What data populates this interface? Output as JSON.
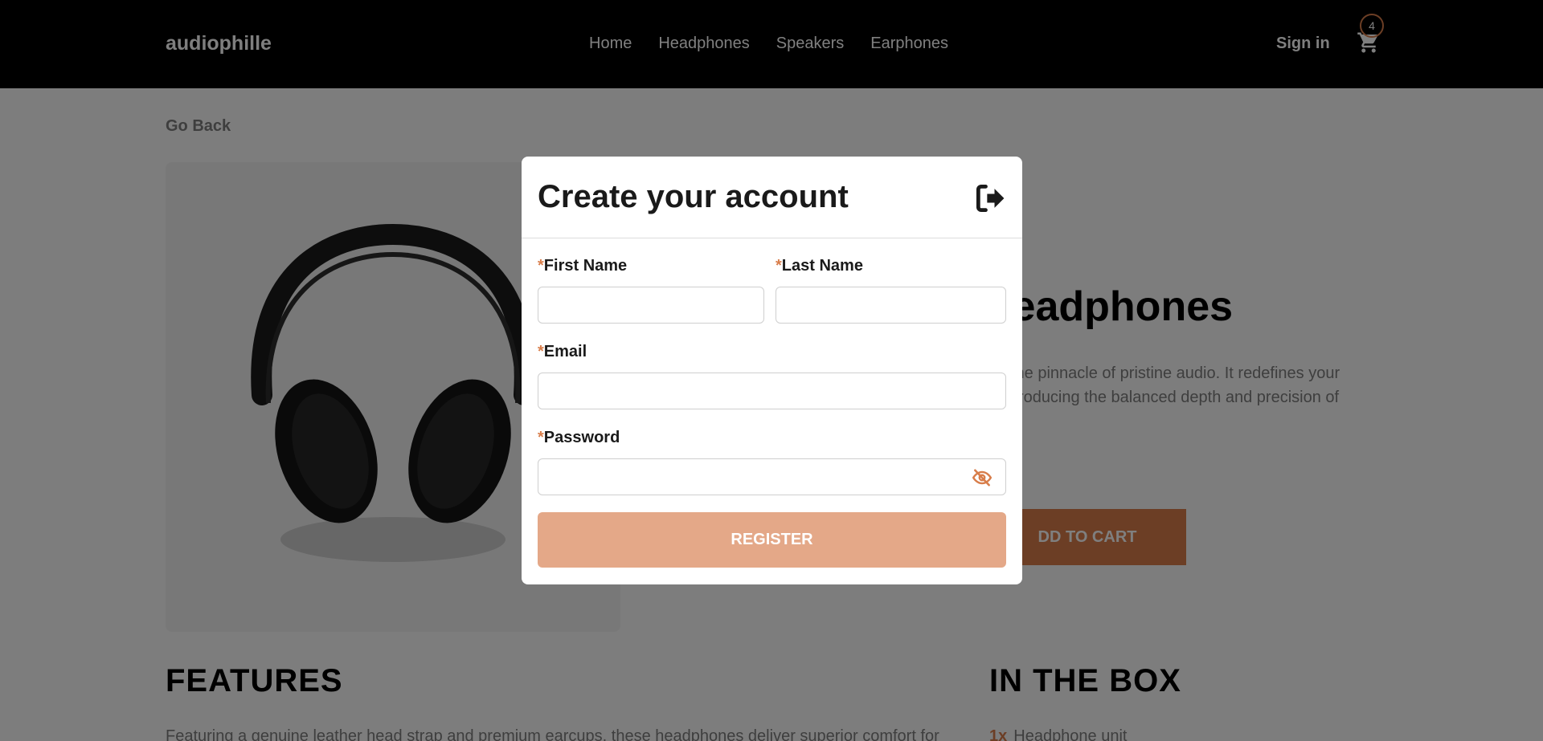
{
  "header": {
    "brand": "audiophille",
    "nav": [
      "Home",
      "Headphones",
      "Speakers",
      "Earphones"
    ],
    "signin": "Sign in",
    "cart_count": "4"
  },
  "page": {
    "go_back": "Go Back",
    "product_title": "Headphones",
    "product_desc": "is the pinnacle of pristine audio. It redefines your reproducing the balanced depth and precision of",
    "add_to_cart": "DD TO CART",
    "features_heading": "FEATURES",
    "features_text": "Featuring a genuine leather head strap and premium earcups, these headphones deliver superior comfort for",
    "inbox_heading": "IN THE BOX",
    "inbox_items": [
      {
        "qty": "1x",
        "name": "Headphone unit"
      }
    ]
  },
  "modal": {
    "title": "Create your account",
    "required_mark": "*",
    "first_name_label": "First Name",
    "last_name_label": "Last Name",
    "email_label": "Email",
    "password_label": "Password",
    "first_name_value": "",
    "last_name_value": "",
    "email_value": "",
    "password_value": "",
    "register_label": "REGISTER"
  },
  "colors": {
    "accent": "#d87d4a",
    "accent_light": "#e4a888",
    "header_bg": "#000000"
  },
  "icons": {
    "close": "sign-out-icon",
    "password_toggle": "eye-slash-icon",
    "cart": "cart-icon"
  }
}
